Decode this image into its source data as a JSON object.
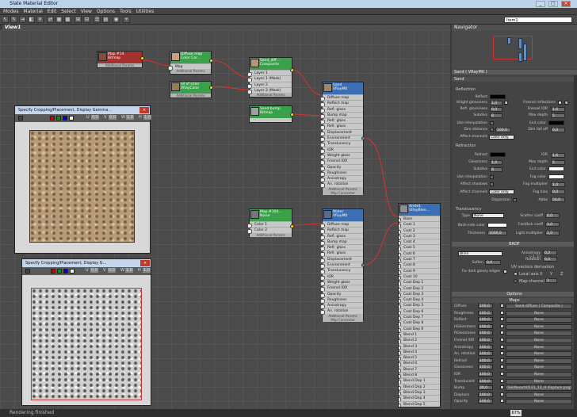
{
  "window_title": "Slate Material Editor",
  "menu": [
    "Modes",
    "Material",
    "Edit",
    "Select",
    "View",
    "Options",
    "Tools",
    "Utilities"
  ],
  "object_field": "Item1",
  "view_tab": "View1",
  "status_text": "Rendering finished",
  "zoom": "67%",
  "nodes": {
    "map14": {
      "title": "Map #14",
      "subtitle": "Bitmap",
      "footer": "Additional Params"
    },
    "diffuse": {
      "title": "Diffuse map",
      "subtitle": "Color Cor...",
      "rows": [
        "Map"
      ],
      "footer": "Additional Params"
    },
    "oil": {
      "title": "oil of color",
      "subtitle": "VRayColor",
      "footer": "Additional Params"
    },
    "composite": {
      "title": "Sand_diff...",
      "subtitle": "Composite",
      "rows": [
        "Layer 1",
        "Layer 1 (Mask)",
        "Layer 2",
        "Layer 2 (Mask)"
      ],
      "footer": "Additional Params"
    },
    "sandbump": {
      "title": "Sand bump",
      "subtitle": "Bitmap"
    },
    "sand": {
      "title": "Sand",
      "subtitle": "VRayMtl",
      "rows": [
        "Diffuse map",
        "Reflect map",
        "Refl. gloss",
        "Bump map",
        "Refr. gloss",
        "Refr. gloss",
        "Displacement",
        "Environment",
        "Translucency",
        "IOR",
        "Weight gloss",
        "Fresnel IOR",
        "Opacity",
        "Roughness",
        "Anisotropy",
        "An. rotation"
      ],
      "footer": "Additional Params",
      "footer2": "Map Connector"
    },
    "map1104": {
      "title": "Map #104...",
      "subtitle": "Noise",
      "rows": [
        "Color 1",
        "Color 2"
      ],
      "footer": "Additional Params"
    },
    "water": {
      "title": "Water",
      "subtitle": "VRayMtl",
      "rows": [
        "Diffuse map",
        "Reflect map",
        "Refl. gloss",
        "Bump map",
        "Refr. gloss",
        "Refr. gloss",
        "Displacement",
        "Environment",
        "Translucency",
        "IOR",
        "Weight gloss",
        "Fresnel IOR",
        "Opacity",
        "Roughness",
        "Anisotropy",
        "An. rotation"
      ],
      "footer": "Additional Params",
      "footer2": "Map Connector"
    },
    "arete": {
      "title": "Arete1",
      "subtitle": "VRayBlen...",
      "rows": [
        "Base",
        "Coat 1",
        "Coat 2",
        "Coat 3",
        "Coat 4",
        "Coat 5",
        "Coat 6",
        "Coat 7",
        "Coat 8",
        "Coat 9",
        "Coat 10",
        "Coat Dep 1",
        "Coat Dep 2",
        "Coat Dep 3",
        "Coat Dep 4",
        "Coat Dep 5",
        "Coat Dep 6",
        "Coat Dep 7",
        "Coat Dep 8",
        "Coat Dep 9",
        "Blend 1",
        "Blend 2",
        "Blend 3",
        "Blend 4",
        "Blend 5",
        "Blend 6",
        "Blend 7",
        "Blend 8",
        "Blend Dep 1",
        "Blend Dep 2",
        "Blend Dep 3",
        "Blend Dep 4",
        "Blend Dep 5",
        "Blend Dep 6"
      ]
    }
  },
  "preview1": {
    "title": "Specify Cropping/Placement, Display Gamma...",
    "u": "U",
    "v": "V",
    "w": "W",
    "h": "H",
    "u_val": "0,0",
    "v_val": "0,0",
    "w_val": "1,0",
    "h_val": "1,0"
  },
  "preview2": {
    "title": "Specify Cropping/Placement, Display G...",
    "u": "U",
    "v": "V",
    "w": "W",
    "h": "H",
    "u_val": "0,0",
    "v_val": "0,0",
    "w_val": "1,0",
    "h_val": "1,0"
  },
  "navigator": "Navigator",
  "material_name": "Sand ( VRayMtl )",
  "panel_header": "Sand",
  "reflection": {
    "group": "Reflection",
    "reflect": "Reflect",
    "hilight": "Hilight glossiness",
    "hilight_val": "1,0",
    "refl_gloss": "Refl. glossiness",
    "refl_gloss_val": "0,0",
    "subdivs": "Subdivs",
    "subdivs_val": "8",
    "use_interp": "Use interpolation",
    "dim_distance": "Dim distance",
    "dim_val": "100,0",
    "affect_channels": "Affect channels",
    "affect_val": "Color only",
    "fresnel": "Fresnel reflections",
    "fresnel_ior": "Fresnel IOR",
    "fresnel_ior_val": "1,6",
    "max_depth": "Max depth",
    "max_depth_val": "5",
    "exit_color": "Exit color",
    "dim_falloff": "Dim fall off",
    "dim_falloff_val": "0,0",
    "l_label": "L"
  },
  "refraction": {
    "group": "Refraction",
    "refract": "Refract",
    "glossiness": "Glossiness",
    "glossiness_val": "1,0",
    "subdivs": "Subdivs",
    "subdivs_val": "8",
    "use_interp": "Use interpolation",
    "affect_shadows": "Affect shadows",
    "affect_channels": "Affect channels",
    "affect_val": "Color only",
    "dispersion": "Dispersion",
    "ior": "IOR",
    "ior_val": "1,6",
    "max_depth": "Max depth",
    "max_depth_val": "5",
    "exit_color": "Exit color",
    "fog_color": "Fog color",
    "fog_mult": "Fog multiplier",
    "fog_mult_val": "1,0",
    "fog_bias": "Fog bias",
    "fog_bias_val": "0,0",
    "abbe": "Abbe",
    "abbe_val": "50,0"
  },
  "translucency": {
    "group": "Translucency",
    "type": "Type",
    "type_val": "None",
    "back_side": "Back-side color",
    "thickness": "Thickness",
    "thickness_val": "1000,0",
    "scatter": "Scatter coeff",
    "scatter_val": "0,0",
    "fwd_bck": "Fwd/bck coeff",
    "fwd_bck_val": "1,0",
    "light_mult": "Light multiplier",
    "light_mult_val": "1,0"
  },
  "brdf": {
    "header": "BRDF",
    "type_val": "Blinn",
    "soften": "Soften",
    "soften_val": "0,0",
    "fix_dark": "Fix dark glossy edges",
    "anisotropy": "Anisotropy (-1..1)",
    "anisotropy_val": "0,0",
    "rotation": "Rotation",
    "rotation_val": "0,0",
    "uv_deriv": "UV vectors derivation",
    "local_axis": "Local axis",
    "x": "X",
    "y": "Y",
    "z": "Z",
    "map_channel": "Map channel",
    "map_channel_val": "1"
  },
  "options_header": "Options",
  "maps_header": "Maps",
  "maps": [
    {
      "label": "Diffuse",
      "amount": "100,0",
      "map": "Sand diffuse ( Composite )"
    },
    {
      "label": "Roughness",
      "amount": "100,0",
      "map": "None"
    },
    {
      "label": "Reflect",
      "amount": "100,0",
      "map": "None"
    },
    {
      "label": "HGlossiness",
      "amount": "100,0",
      "map": "None"
    },
    {
      "label": "RGlossiness",
      "amount": "100,0",
      "map": "None"
    },
    {
      "label": "Fresnel IOR",
      "amount": "100,0",
      "map": "None"
    },
    {
      "label": "Anisotropy",
      "amount": "100,0",
      "map": "None"
    },
    {
      "label": "An. rotation",
      "amount": "100,0",
      "map": "None"
    },
    {
      "label": "Refract",
      "amount": "100,0",
      "map": "None"
    },
    {
      "label": "Glossiness",
      "amount": "100,0",
      "map": "None"
    },
    {
      "label": "IOR",
      "amount": "100,0",
      "map": "None"
    },
    {
      "label": "Translucent",
      "amount": "100,0",
      "map": "None"
    },
    {
      "label": "Bump",
      "amount": "30,0",
      "map": "(Soil/beach0131_13_H displace.png)"
    },
    {
      "label": "Displace",
      "amount": "100,0",
      "map": "None"
    },
    {
      "label": "Opacity",
      "amount": "100,0",
      "map": "None"
    }
  ]
}
